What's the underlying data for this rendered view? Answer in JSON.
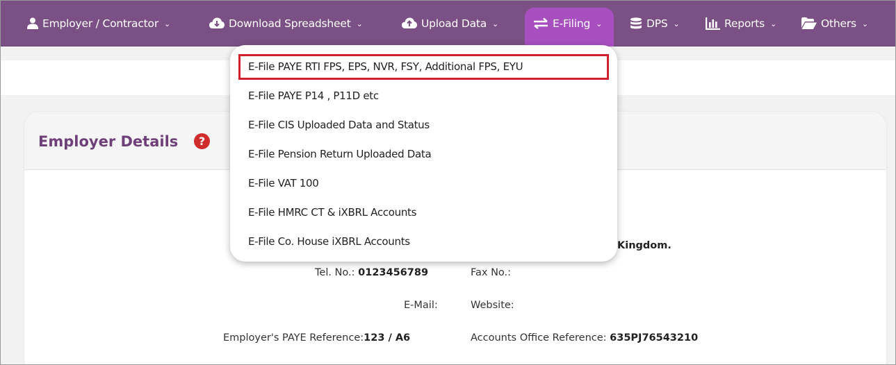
{
  "nav": {
    "items": [
      {
        "label": "Employer / Contractor",
        "icon": "user-icon"
      },
      {
        "label": "Download Spreadsheet",
        "icon": "cloud-download-icon"
      },
      {
        "label": "Upload Data",
        "icon": "cloud-upload-icon"
      },
      {
        "label": "E-Filing",
        "icon": "exchange-icon",
        "active": true
      },
      {
        "label": "DPS",
        "icon": "database-icon"
      },
      {
        "label": "Reports",
        "icon": "bar-chart-icon"
      },
      {
        "label": "Others",
        "icon": "folder-open-icon"
      }
    ]
  },
  "dropdown": {
    "items": [
      "E-File PAYE RTI FPS, EPS, NVR, FSY, Additional FPS, EYU",
      "E-File PAYE P14 , P11D etc",
      "E-File CIS Uploaded Data and Status",
      "E-File Pension Return Uploaded Data",
      "E-File VAT 100",
      "E-File HMRC CT & iXBRL Accounts",
      "E-File Co. House iXBRL Accounts"
    ]
  },
  "card": {
    "title": "Employer Details",
    "help": "?",
    "address_tail": "Kingdom.",
    "tel_label": "Tel. No.:",
    "tel_value": "0123456789",
    "fax_label": "Fax No.:",
    "email_label": "E-Mail:",
    "website_label": "Website:",
    "paye_label": "Employer's PAYE Reference:",
    "paye_value": "123 / A6",
    "aor_label": "Accounts Office Reference:",
    "aor_value": "635PJ76543210"
  },
  "colors": {
    "nav_bg": "#7b5185",
    "nav_active": "#a84fc0",
    "title": "#6e3f79",
    "highlight_border": "#d11f2d",
    "help_icon": "#d12c2c"
  }
}
